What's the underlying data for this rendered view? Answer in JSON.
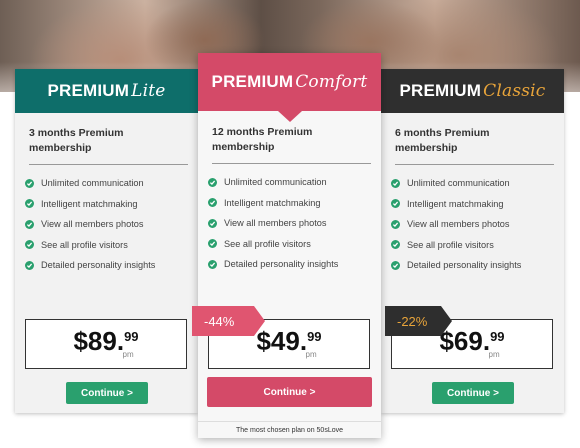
{
  "plans": {
    "lite": {
      "brand": "PREMIUM",
      "variant": "Lite",
      "subtitle": "3 months Premium membership",
      "features": [
        "Unlimited communication",
        "Intelligent matchmaking",
        "View all members photos",
        "See all profile visitors",
        "Detailed personality insights"
      ],
      "price_whole": "$89.",
      "price_cents": "99",
      "price_unit": "pm",
      "button": "Continue >"
    },
    "comfort": {
      "brand": "PREMIUM",
      "variant": "Comfort",
      "subtitle": "12 months Premium membership",
      "features": [
        "Unlimited communication",
        "Intelligent matchmaking",
        "View all members photos",
        "See all profile visitors",
        "Detailed personality insights"
      ],
      "price_whole": "$49.",
      "price_cents": "99",
      "price_unit": "pm",
      "button": "Continue >",
      "discount": "-44%",
      "note": "The most chosen plan on 50sLove"
    },
    "classic": {
      "brand": "PREMIUM",
      "variant": "Classic",
      "subtitle": "6 months Premium membership",
      "features": [
        "Unlimited communication",
        "Intelligent matchmaking",
        "View all members photos",
        "See all profile visitors",
        "Detailed personality insights"
      ],
      "price_whole": "$69.",
      "price_cents": "99",
      "price_unit": "pm",
      "button": "Continue >",
      "discount": "-22%"
    }
  },
  "colors": {
    "lite_header": "#0e6e6a",
    "comfort_header": "#d44a68",
    "classic_header": "#2f2f2f",
    "classic_accent": "#e8a43a",
    "check": "#2aa06e",
    "continue_green": "#2aa06e"
  },
  "icons": {
    "feature_check": "check-circle-icon"
  }
}
